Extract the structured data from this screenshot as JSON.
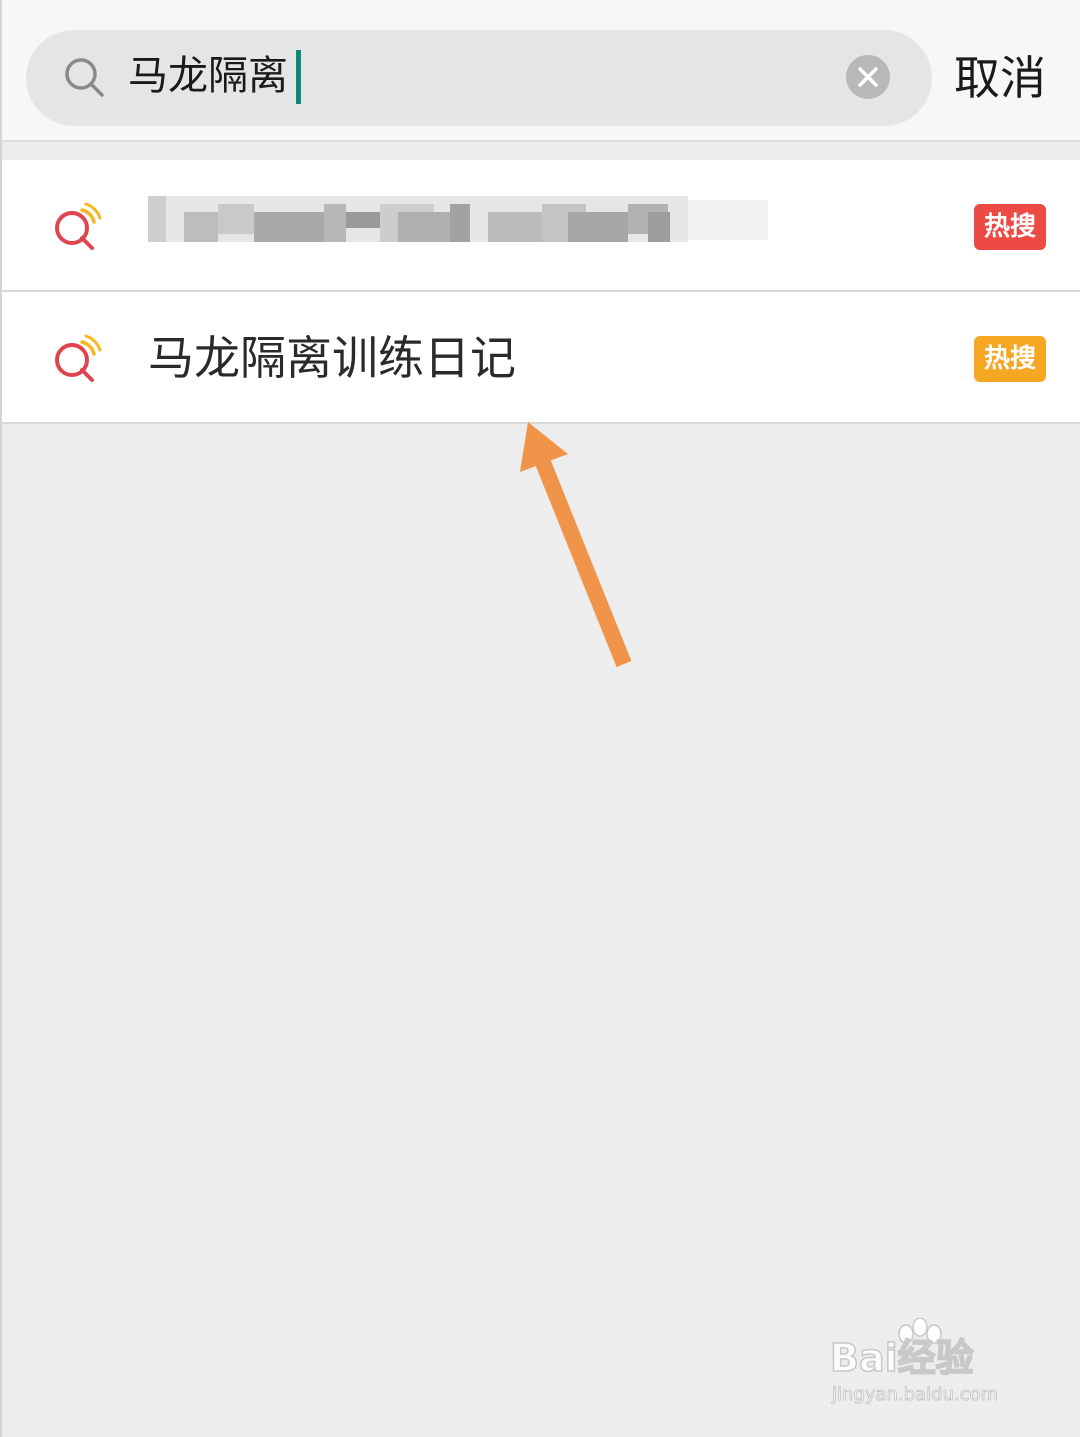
{
  "search": {
    "query": "马龙隔离",
    "cancel_label": "取消",
    "icon": "search-icon",
    "clear_icon": "clear-icon"
  },
  "suggestions": [
    {
      "label": "",
      "blurred": true,
      "badge": "热搜",
      "badge_color": "#ee4a45",
      "icon": "hot-search-icon"
    },
    {
      "label": "马龙隔离训练日记",
      "blurred": false,
      "badge": "热搜",
      "badge_color": "#f5a623",
      "icon": "hot-search-icon"
    }
  ],
  "colors": {
    "accent_caret": "#0f8a7a",
    "arrow": "#f0944a",
    "badge_red": "#ee4a45",
    "badge_orange": "#f5a623"
  },
  "watermark": {
    "brand": "Bai经验",
    "url": "jingyan.baidu.com"
  }
}
